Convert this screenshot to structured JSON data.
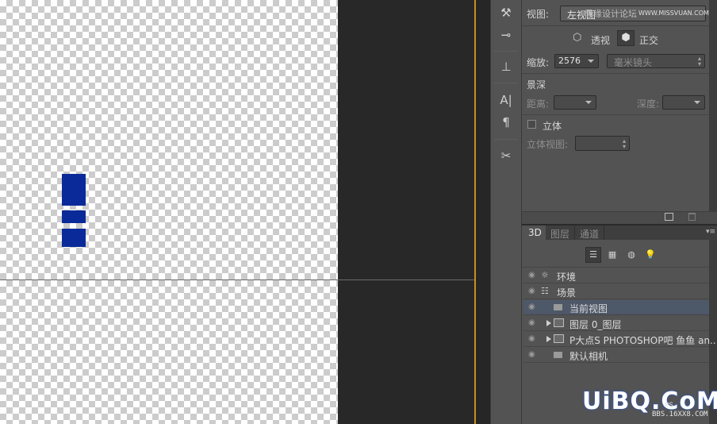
{
  "tools": [
    {
      "name": "brush-tool-icon",
      "glyph": "⚒"
    },
    {
      "name": "adjust-tool-icon",
      "glyph": "⊸"
    },
    {
      "name": "clone-stamp-icon",
      "glyph": "⊥"
    },
    {
      "name": "character-icon",
      "glyph": "A|"
    },
    {
      "name": "paragraph-icon",
      "glyph": "¶"
    },
    {
      "name": "tools-cross-icon",
      "glyph": "✂"
    }
  ],
  "properties": {
    "view_label": "视图:",
    "view_value": "左视图",
    "view_overlay": "思缘设计论坛",
    "watermark_url": "WWW.MISSVUAN.COM",
    "perspective_label": "透视",
    "orthographic_label": "正交",
    "zoom_label": "缩放:",
    "zoom_value": "2576",
    "zoom_unit": "毫米镜头",
    "dof_label": "景深",
    "distance_label": "距离:",
    "depth_label": "深度:",
    "stereo_label": "立体",
    "stereo_view_label": "立体视图:"
  },
  "panel_tabs": [
    "3D",
    "图层",
    "通道"
  ],
  "scene_items": [
    {
      "label": "环境",
      "icon": "environment-icon",
      "indent": 0,
      "expand": false,
      "selected": false
    },
    {
      "label": "场景",
      "icon": "scene-icon",
      "indent": 0,
      "expand": false,
      "selected": false
    },
    {
      "label": "当前视图",
      "icon": "camera-icon",
      "indent": 1,
      "expand": false,
      "selected": true
    },
    {
      "label": "图层 0_图层",
      "icon": "mesh-icon",
      "indent": 1,
      "expand": true,
      "selected": false
    },
    {
      "label": "P大点S PHOTOSHOP吧 鱼鱼 an...",
      "icon": "mesh-icon",
      "indent": 1,
      "expand": true,
      "selected": false
    },
    {
      "label": "默认相机",
      "icon": "camera-icon",
      "indent": 1,
      "expand": false,
      "selected": false
    }
  ],
  "watermark": {
    "logo": "UiBQ.CoM",
    "ps": "PS",
    "site": "BBS.16XX8.COM"
  },
  "colors": {
    "accent_shape": "#0a2a9a",
    "logo": "#ffffff",
    "app_border": "#c8901c"
  }
}
